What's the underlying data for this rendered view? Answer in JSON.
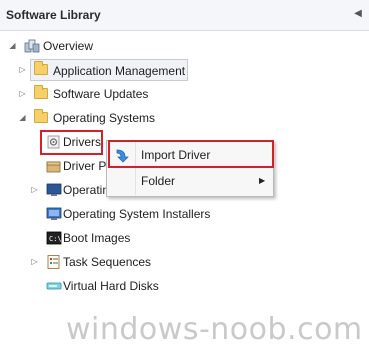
{
  "panel": {
    "title": "Software Library"
  },
  "tree": {
    "overview": "Overview",
    "application_management": "Application Management",
    "software_updates": "Software Updates",
    "operating_systems": "Operating Systems",
    "drivers": "Drivers",
    "driver_packages_visible": "Driver P",
    "os_images_visible": "Operating",
    "os_images_partial_suffix": "g",
    "os_installers": "Operating System Installers",
    "boot_images": "Boot Images",
    "task_sequences": "Task Sequences",
    "virtual_hard_disks": "Virtual Hard Disks"
  },
  "context_menu": {
    "import_driver": "Import Driver",
    "folder": "Folder"
  },
  "watermark": "windows-noob.com",
  "colors": {
    "highlight": "#d4202b",
    "folder": "#f5cf6a"
  }
}
